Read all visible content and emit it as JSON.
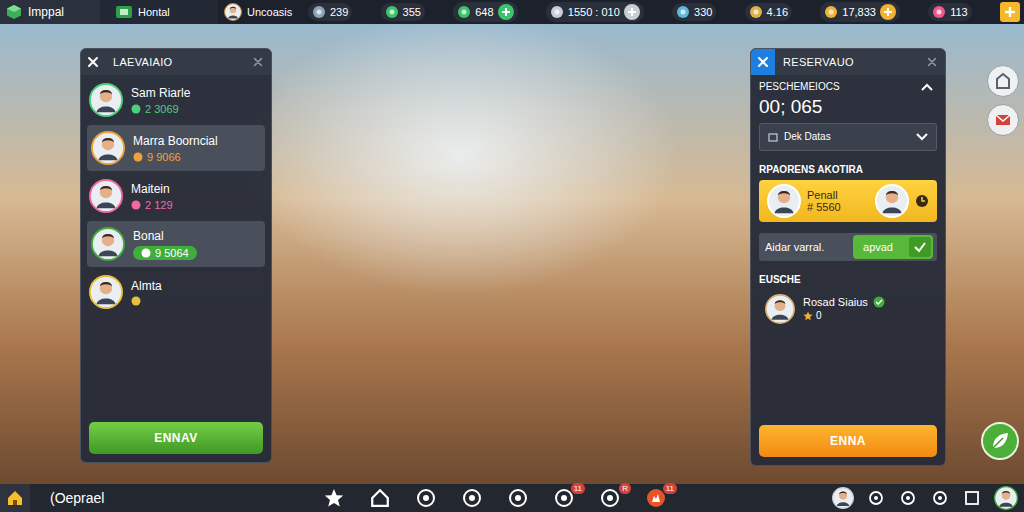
{
  "top_bar": {
    "logo": "Imppal",
    "location": "Hontal",
    "player": "Uncoasis",
    "resources": [
      {
        "value": "239",
        "color": "#8fa3b8",
        "plus": false
      },
      {
        "value": "355",
        "color": "#3cc46a",
        "plus": false
      },
      {
        "value": "648",
        "color": "#3cc46a",
        "plus": true
      },
      {
        "value": "1550 : 010",
        "color": "#c9ced6",
        "plus": true
      },
      {
        "value": "330",
        "color": "#5fb8d9",
        "plus": false
      },
      {
        "value": "4.16",
        "color": "#e0b04a",
        "plus": false
      },
      {
        "value": "17,833",
        "color": "#f2b233",
        "plus": true
      },
      {
        "value": "113",
        "color": "#f05a8a",
        "plus": false
      }
    ]
  },
  "guest_panel": {
    "title": "LAEVAIAIO",
    "items": [
      {
        "name": "Sam Riarle",
        "value": "2 3069",
        "color": "#4cd07a",
        "kind": "plain",
        "selected": false
      },
      {
        "name": "Marra Boorncial",
        "value": "9 9066",
        "color": "#f0a23a",
        "kind": "plain",
        "selected": true
      },
      {
        "name": "Maitein",
        "value": "2 129",
        "color": "#f06aa0",
        "kind": "plain",
        "selected": false
      },
      {
        "name": "Bonal",
        "value": "9 5064",
        "color": "#3fae3a",
        "kind": "pill",
        "selected": true
      },
      {
        "name": "Almta",
        "color": "#e8c23a",
        "kind": "plain",
        "selected": false
      }
    ],
    "button": "ENNAV"
  },
  "reservation_panel": {
    "title": "RESERVAUO",
    "section": "PESCHEMEIOCS",
    "expanded": true,
    "timer": "00; 065",
    "dropdown": "Dek Datas",
    "request_title": "RPAORENS AKOTIRA",
    "request": {
      "name": "Penall",
      "amount": "# 5560"
    },
    "toggle_row": {
      "label": "Aidar varral.",
      "toggle": "apvad",
      "on": true
    },
    "staff_title": "EUSCHE",
    "staff": [
      {
        "name": "Rosad Siaius",
        "verified": true,
        "rating": "0"
      }
    ],
    "button": "ENNA"
  },
  "bottom_bar": {
    "label": "(Oeprael",
    "nav": [
      {},
      {},
      {},
      {},
      {},
      {
        "badge": "11"
      },
      {
        "badge": "R"
      },
      {
        "badge": "11"
      }
    ]
  }
}
